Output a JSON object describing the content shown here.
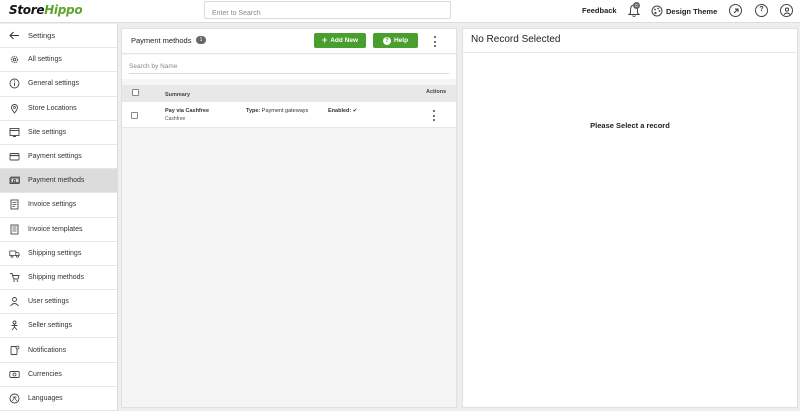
{
  "app": {
    "logo_part1": "Store",
    "logo_part2": "Hippo",
    "search_placeholder": "Enter to Search",
    "feedback_label": "Feedback",
    "notification_count": "0",
    "theme_label": "Design Theme",
    "brand_color": "#5da52a",
    "accent_green": "#4a9e2e"
  },
  "sidebar": {
    "back_label": "Settings",
    "items": [
      {
        "label": "All settings",
        "icon": "gear-icon"
      },
      {
        "label": "General settings",
        "icon": "info-icon"
      },
      {
        "label": "Store Locations",
        "icon": "location-pin-icon"
      },
      {
        "label": "Site settings",
        "icon": "site-icon"
      },
      {
        "label": "Payment settings",
        "icon": "card-icon"
      },
      {
        "label": "Payment methods",
        "icon": "money-icon",
        "active": true
      },
      {
        "label": "Invoice settings",
        "icon": "invoice-icon"
      },
      {
        "label": "Invoice templates",
        "icon": "template-icon"
      },
      {
        "label": "Shipping settings",
        "icon": "truck-icon"
      },
      {
        "label": "Shipping methods",
        "icon": "cart-icon"
      },
      {
        "label": "User settings",
        "icon": "user-icon"
      },
      {
        "label": "Seller settings",
        "icon": "seller-icon"
      },
      {
        "label": "Notifications",
        "icon": "notification-icon"
      },
      {
        "label": "Currencies",
        "icon": "currency-icon"
      },
      {
        "label": "Languages",
        "icon": "language-icon"
      }
    ]
  },
  "list_panel": {
    "title": "Payment methods",
    "count": "1",
    "add_new_label": "Add New",
    "help_label": "Help",
    "search_placeholder": "Search by Name",
    "columns": {
      "summary": "Summary",
      "actions": "Actions"
    },
    "rows": [
      {
        "name": "Pay via Cashfree",
        "subtitle": "Cashfree",
        "type_label": "Type:",
        "type_value": "Payment gateways",
        "enabled_label": "Enabled:",
        "enabled_mark": "✔"
      }
    ]
  },
  "detail_panel": {
    "title": "No Record Selected",
    "message": "Please Select a record"
  }
}
